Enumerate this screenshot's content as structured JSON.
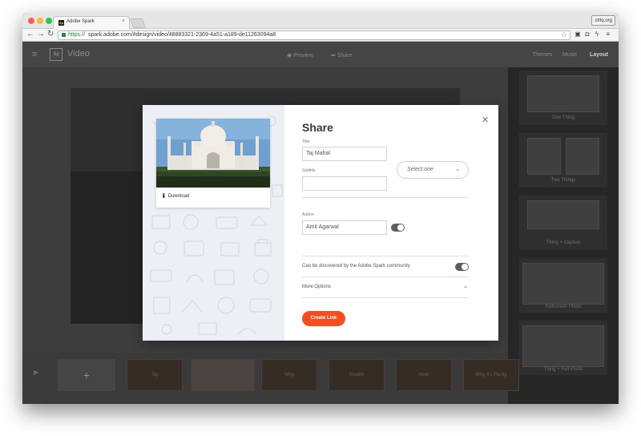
{
  "browser": {
    "tab_title": "Adobe Spark",
    "tab_favicon": "Sp",
    "tab_close": "×",
    "extension_badge": "ctrlq.org",
    "url_scheme": "https://",
    "url_rest": "spark.adobe.com/#design/video/48883321-2369-4a51-a189-de11263094a8",
    "colors": {
      "secure": "#1f8a3a"
    }
  },
  "app": {
    "logo": "Sp",
    "name": "Video",
    "header_items": [
      "Preview",
      "Share"
    ],
    "right_menu": [
      "Themes",
      "Music",
      "Layout"
    ],
    "layouts": [
      "One Thing",
      "Two Things",
      "Thing + Caption",
      "Fullscreen Photo",
      "Thing + Full Photo"
    ],
    "timeline_add": "+",
    "timeline_slides": [
      "Taj",
      "",
      "Why",
      "Stealth",
      "How",
      "Why it's Plenty"
    ]
  },
  "modal": {
    "title": "Share",
    "close": "×",
    "download_label": "Download",
    "title_label": "Title",
    "title_value": "Taj Mahal",
    "subtitle_label": "Subtitle",
    "subtitle_value": "",
    "category_placeholder": "Select one",
    "author_label": "Author",
    "author_value": "Amit Agarwal",
    "author_toggle_on": true,
    "discover_label": "Can be discovered by the Adobe Spark community",
    "discover_toggle_on": true,
    "more_options": "More Options",
    "create_link": "Create Link",
    "colors": {
      "accent": "#f24e22",
      "heading": "#2e3a45"
    }
  }
}
